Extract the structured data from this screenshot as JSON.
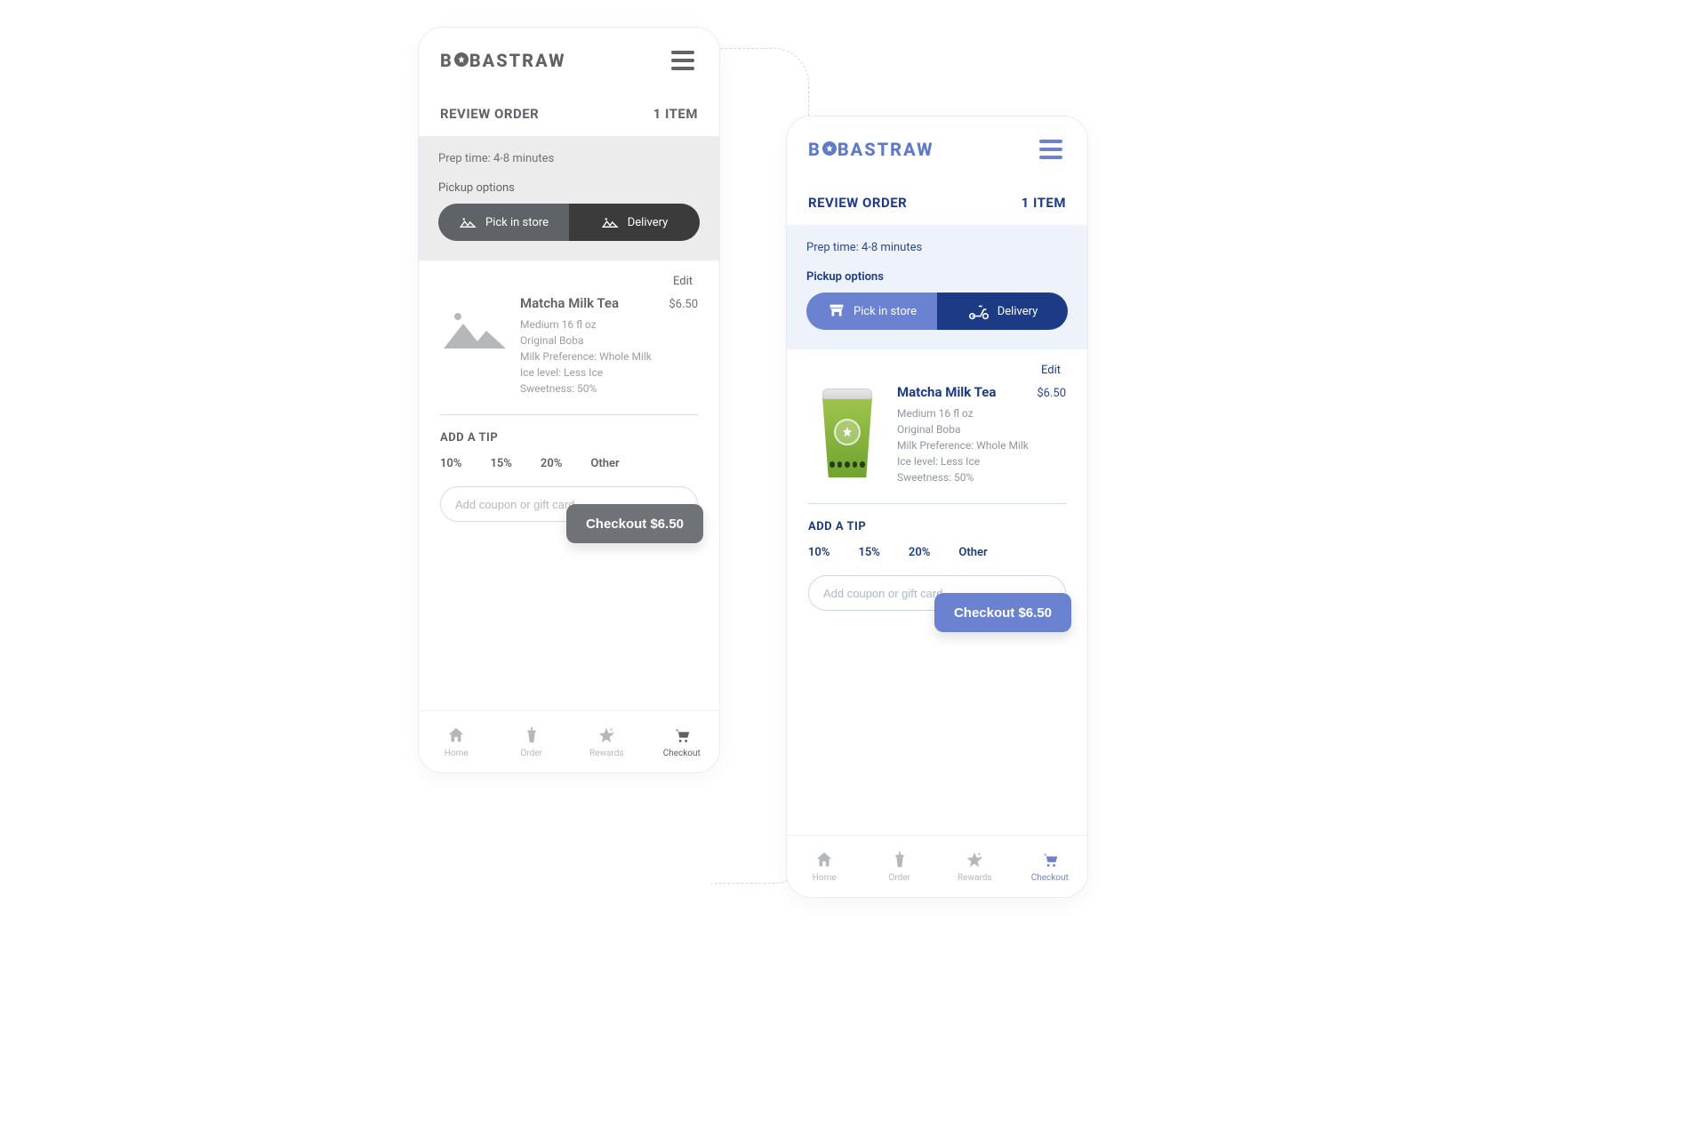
{
  "brand": "BOBASTRAW",
  "review": {
    "title": "REVIEW ORDER",
    "count_label": "1 ITEM"
  },
  "prep": "Prep time: 4-8 minutes",
  "pickup_label": "Pickup options",
  "pickup_options": {
    "in_store": "Pick in store",
    "delivery": "Delivery"
  },
  "edit_label": "Edit",
  "item": {
    "name": "Matcha Milk Tea",
    "price": "$6.50",
    "attrs": [
      "Medium 16 fl oz",
      "Original Boba",
      "Milk Preference: Whole Milk",
      "Ice level: Less Ice",
      "Sweetness: 50%"
    ]
  },
  "tip": {
    "title": "ADD A TIP",
    "options": [
      "10%",
      "15%",
      "20%",
      "Other"
    ]
  },
  "coupon_placeholder": "Add coupon or gift card",
  "checkout_label": "Checkout $6.50",
  "tabs": {
    "home": "Home",
    "order": "Order",
    "rewards": "Rewards",
    "checkout": "Checkout"
  },
  "colors": {
    "variant_a_text": "#5f6367",
    "variant_b_primary": "#1d3b85",
    "variant_b_accent": "#6a82d0"
  }
}
